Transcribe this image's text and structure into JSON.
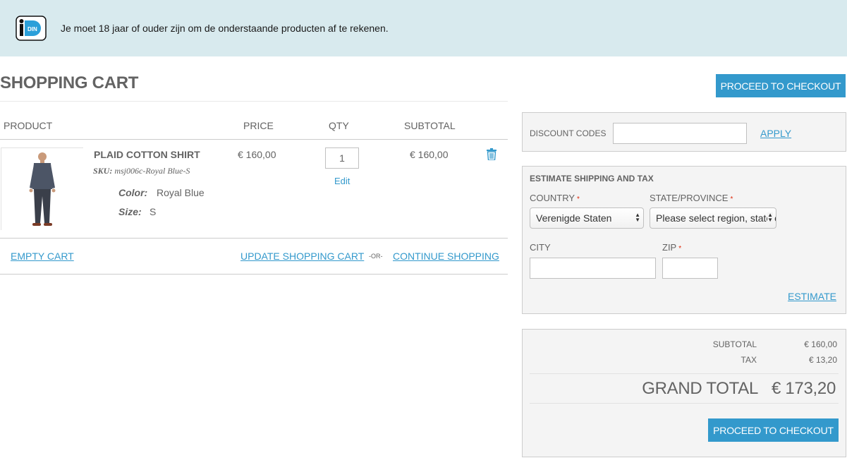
{
  "notice": {
    "logo_text": "iDIN",
    "text": "Je moet 18 jaar of ouder zijn om de onderstaande producten af te rekenen."
  },
  "page": {
    "title": "SHOPPING CART",
    "checkout_label": "PROCEED TO CHECKOUT"
  },
  "cart": {
    "headers": {
      "product": "PRODUCT",
      "price": "PRICE",
      "qty": "QTY",
      "subtotal": "SUBTOTAL"
    },
    "items": [
      {
        "name": "PLAID COTTON SHIRT",
        "sku_label": "SKU:",
        "sku": "msj006c-Royal Blue-S",
        "options": [
          {
            "label": "Color:",
            "value": "Royal Blue"
          },
          {
            "label": "Size:",
            "value": "S"
          }
        ],
        "price": "€ 160,00",
        "qty": "1",
        "edit_label": "Edit",
        "subtotal": "€ 160,00",
        "remove_icon": "trash-icon"
      }
    ],
    "actions": {
      "empty": "EMPTY CART",
      "update": "UPDATE SHOPPING CART",
      "or": "-OR-",
      "continue": "CONTINUE SHOPPING"
    }
  },
  "discount": {
    "label": "DISCOUNT CODES",
    "value": "",
    "apply": "APPLY"
  },
  "shipping": {
    "title": "ESTIMATE SHIPPING AND TAX",
    "country_label": "COUNTRY",
    "country_value": "Verenigde Staten",
    "state_label": "STATE/PROVINCE",
    "state_value": "Please select region, state or province",
    "city_label": "CITY",
    "city_value": "",
    "zip_label": "ZIP",
    "zip_value": "",
    "required_mark": "*",
    "estimate": "ESTIMATE"
  },
  "totals": {
    "subtotal_label": "SUBTOTAL",
    "subtotal_value": "€ 160,00",
    "tax_label": "TAX",
    "tax_value": "€ 13,20",
    "grand_label": "GRAND TOTAL",
    "grand_value": "€ 173,20",
    "checkout_label": "PROCEED TO CHECKOUT"
  },
  "colors": {
    "accent": "#3399cc",
    "banner_bg": "#d8eaee",
    "text": "#636363",
    "required": "#df280a"
  }
}
